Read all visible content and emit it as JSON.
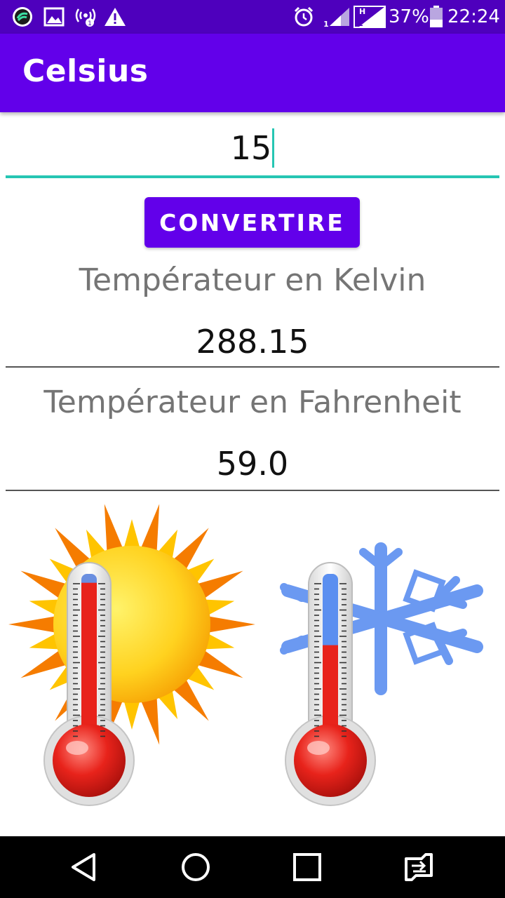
{
  "status_bar": {
    "battery_percent": "37%",
    "time": "22:24",
    "sim2_label": "H",
    "icons": [
      "app-notification-icon",
      "gallery-icon",
      "hotspot-icon",
      "warning-icon",
      "alarm-icon",
      "signal-sim1-icon",
      "signal-sim2-icon",
      "battery-icon"
    ]
  },
  "app_bar": {
    "title": "Celsius"
  },
  "input": {
    "value": "15"
  },
  "button": {
    "label": "CONVERTIRE"
  },
  "results": {
    "kelvin_label": "Températeur en Kelvin",
    "kelvin_value": "288.15",
    "fahrenheit_label": "Températeur en Fahrenheit",
    "fahrenheit_value": "59.0"
  },
  "illustration": {
    "hot_thermometer_level": 0.95,
    "cold_thermometer_level": 0.6
  },
  "nav_bar": {
    "buttons": [
      "back-icon",
      "home-icon",
      "recents-icon",
      "switch-sim-icon"
    ]
  },
  "colors": {
    "primary": "#6200ea",
    "primary_dark": "#4e00bd",
    "accent": "#26c6b3"
  }
}
